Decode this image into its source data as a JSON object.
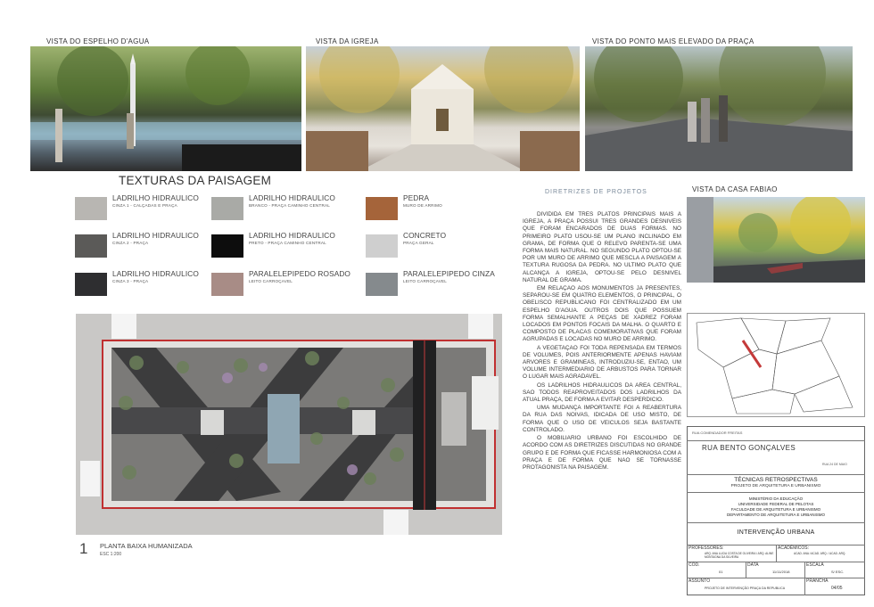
{
  "views": {
    "view1": "VISTA DO ESPELHO D'AGUA",
    "view2": "VISTA DA IGREJA",
    "view3": "VISTA DO PONTO MAIS ELEVADO DA PRAÇA",
    "view4": "VISTA DA CASA FABIAO"
  },
  "textures": {
    "title": "TEXTURAS DA PAISAGEM",
    "items": [
      {
        "label": "LADRILHO HIDRAULICO",
        "sub": "CINZA 1 - CALÇADAS E PRAÇA",
        "color": "#b8b6b2"
      },
      {
        "label": "LADRILHO HIDRAULICO",
        "sub": "CINZA 2 - PRAÇA",
        "color": "#5b5a58"
      },
      {
        "label": "LADRILHO HIDRAULICO",
        "sub": "CINZA 3 - PRAÇA",
        "color": "#2e2e30"
      },
      {
        "label": "LADRILHO HIDRAULICO",
        "sub": "BRANCO - PRAÇA CAMINHO CENTRAL",
        "color": "#a9aaa6"
      },
      {
        "label": "LADRILHO HIDRAULICO",
        "sub": "PRETO - PRAÇA CAMINHO CENTRAL",
        "color": "#0d0d0d"
      },
      {
        "label": "PARALELEPIPEDO ROSADO",
        "sub": "LEITO CARROÇAVEL",
        "color": "#a88c86"
      },
      {
        "label": "PEDRA",
        "sub": "MURO DE ARRIMO",
        "color": "#a5643a"
      },
      {
        "label": "CONCRETO",
        "sub": "PRAÇA GERAL",
        "color": "#cfcfcf"
      },
      {
        "label": "PARALELEPIPEDO CINZA",
        "sub": "LEITO CARROÇAVEL",
        "color": "#858a8d"
      }
    ]
  },
  "plan": {
    "number": "1",
    "title": "PLANTA BAIXA HUMANIZADA",
    "scale": "ESC 1:200"
  },
  "guidelines": {
    "title": "DIRETRIZES DE PROJETOS",
    "paragraphs": [
      "DIVIDIDA EM TRES PLATOS PRINCIPAIS MAIS A IGREJA, A PRAÇA POSSUI TRES GRANDES DESNIVEIS QUE FORAM ENCARADOS DE DUAS FORMAS. NO PRIMEIRO PLATO USOU-SE UM PLANO INCLINADO EM GRAMA, DE FORMA QUE O RELEVO PARENTA-SE UMA FORMA MAIS NATURAL. NO SEGUNDO PLATO OPTOU-SE POR UM MURO DE ARRIMO QUE MESCLA A PAISAGEM A TEXTURA RUGOSA DA PEDRA. NO ULTIMO PLATO QUE ALCANÇA A IGREJA, OPTOU-SE PELO DESNIVEL NATURAL DE GRAMA.",
      "EM RELAÇAO AOS MONUMENTOS JA PRESENTES, SEPAROU-SE EM QUATRO ELEMENTOS, O PRINCIPAL, O OBELISCO REPUBLICANO FOI CENTRALIZADO EM UM ESPELHO D'AGUA. OUTROS DOIS QUE POSSUEM FORMA SEMALHANTE A PEÇAS DE XADREZ FORAM LOCADOS EM PONTOS FOCAIS DA MALHA. O QUARTO E COMPOSTO DE PLACAS COMEMORATIVAS QUE FORAM AGRUPADAS E LOCADAS NO MURO DE ARRIMO.",
      "A VEGETAÇAO FOI TODA REPENSADA EM TERMOS DE VOLUMES, POIS ANTERIORMENTE APENAS HAVIAM ARVORES E GRAMINEAS, INTRODUZIU-SE, ENTAO, UM VOLUME INTERMEDIARIO DE ARBUSTOS PARA TORNAR O LUGAR MAIS AGRADAVEL.",
      "OS LADRILHOS HIDRAULICOS DA AREA CENTRAL, SAO TODOS REAPROVEITADOS DOS LADRILHOS DA ATUAL PRAÇA, DE FORMA A EVITAR DESPERDICIO.",
      "UMA MUDANÇA IMPORTANTE FOI A REABERTURA DA RUA DAS NOIVAS, IDICADA DE USO MISTO, DE FORMA QUE O USO DE VEICULOS SEJA BASTANTE CONTROLADO.",
      "O MOBILIARIO URBANO FOI ESCOLHIDO DE ACORDO COM AS DIRETRIZES DISCUTIDAS NO GRANDE GRUPO E DE FORMA QUE FICASSE HARMONIOSA COM A PRAÇA E DE FORMA QUE NAO SE TORNASSE PROTAGONISTA NA PAISAGEM."
    ]
  },
  "titleblock": {
    "street_small": "RUA COMENDADOR FREITAS",
    "street": "RUA BENTO GONÇALVES",
    "street_sub": "RUA 24 DE MAIO",
    "course": "TÉCNICAS RETROSPECTIVAS",
    "course_sub": "PROJETO DE ARQUITETURA E URBANISMO",
    "inst1": "MINISTÉRIO DA EDUCAÇÃO",
    "inst2": "UNIVERSIDADE FEDERAL DE PELOTAS",
    "inst3": "FACULDADE DE ARQUITETURA E URBANISMO",
    "inst4": "DEPARTAMENTO DE ARQUITETURA E URBANISMO",
    "project": "INTERVENÇÃO URBANA",
    "professores_label": "PROFESSORES:",
    "professores": "ARQ. ANA LUCIA COSTA DE OLIVEIRA / ARQ. ALINE MONTAGNA DA SILVEIRA",
    "academicos_label": "ACADÊMICOS:",
    "academicos": "ACAD. ANA / ACAD. ARQ. / ACAD. ARQ.",
    "cod_label": "CÓD.",
    "cod": "01",
    "data_label": "DATA",
    "data": "11/11/2018",
    "escala_label": "ESCALA",
    "escala": "S/ ESC.",
    "assunto_label": "ASSUNTO",
    "assunto": "PROJETO DE INTERVENÇÃO PRAÇA DA REPUBLICA",
    "prancha_label": "PRANCHA",
    "prancha": "04/05"
  }
}
